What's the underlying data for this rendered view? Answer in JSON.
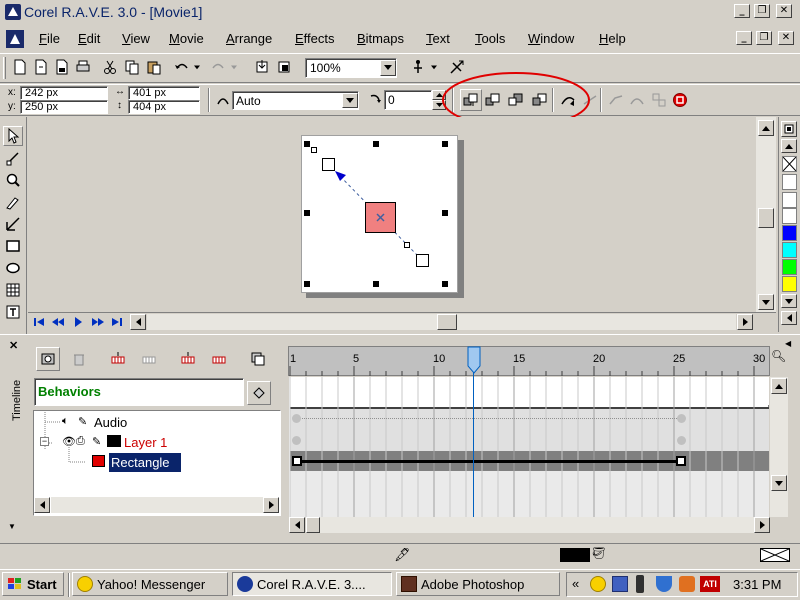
{
  "window": {
    "title": "Corel R.A.V.E. 3.0 - [Movie1]",
    "title_color": "#0a246a"
  },
  "menu": {
    "items": [
      {
        "label": "File",
        "key": "F",
        "rest": "ile"
      },
      {
        "label": "Edit",
        "key": "E",
        "rest": "dit"
      },
      {
        "label": "View",
        "key": "V",
        "rest": "iew"
      },
      {
        "label": "Movie",
        "key": "M",
        "rest": "ovie"
      },
      {
        "label": "Arrange",
        "key": "A",
        "rest": "rrange"
      },
      {
        "label": "Effects",
        "key": "E",
        "rest": "ffects"
      },
      {
        "label": "Bitmaps",
        "key": "B",
        "rest": "itmaps"
      },
      {
        "label": "Text",
        "key": "T",
        "rest": "ext"
      },
      {
        "label": "Tools",
        "key": "T",
        "rest": "ools"
      },
      {
        "label": "Window",
        "key": "W",
        "rest": "indow"
      },
      {
        "label": "Help",
        "key": "H",
        "rest": "elp"
      }
    ]
  },
  "toolbar": {
    "zoom_value": "100%"
  },
  "property_bar": {
    "x_label": "x:",
    "x_value": "242 px",
    "y_label": "y:",
    "y_value": "250 px",
    "width_value": "401 px",
    "height_value": "404 px",
    "tween_value": "Auto",
    "rotation_value": "0",
    "highlight_color": "#e00000"
  },
  "timeline": {
    "label": "Timeline",
    "behaviors_label": "Behaviors",
    "behaviors_color": "#008000",
    "frame_numbers": [
      "1",
      "5",
      "10",
      "15",
      "20",
      "25",
      "30"
    ],
    "current_frame": 12,
    "layers": [
      {
        "name": "Audio",
        "color": "#000000"
      },
      {
        "name": "Layer 1",
        "color": "#cc0000"
      },
      {
        "name": "Rectangle",
        "color": "#ffffff",
        "selected_bg": "#0a246a"
      }
    ]
  },
  "palette": {
    "colors": [
      "#ffffff",
      "#0000ff",
      "#00ffff",
      "#00ff00",
      "#ffff00"
    ]
  },
  "shape": {
    "fill": "#f08080"
  },
  "taskbar": {
    "start_label": "Start",
    "tasks": [
      {
        "label": "Yahoo! Messenger"
      },
      {
        "label": "Corel R.A.V.E. 3...."
      },
      {
        "label": "Adobe Photoshop"
      }
    ],
    "clock": "3:31 PM"
  }
}
